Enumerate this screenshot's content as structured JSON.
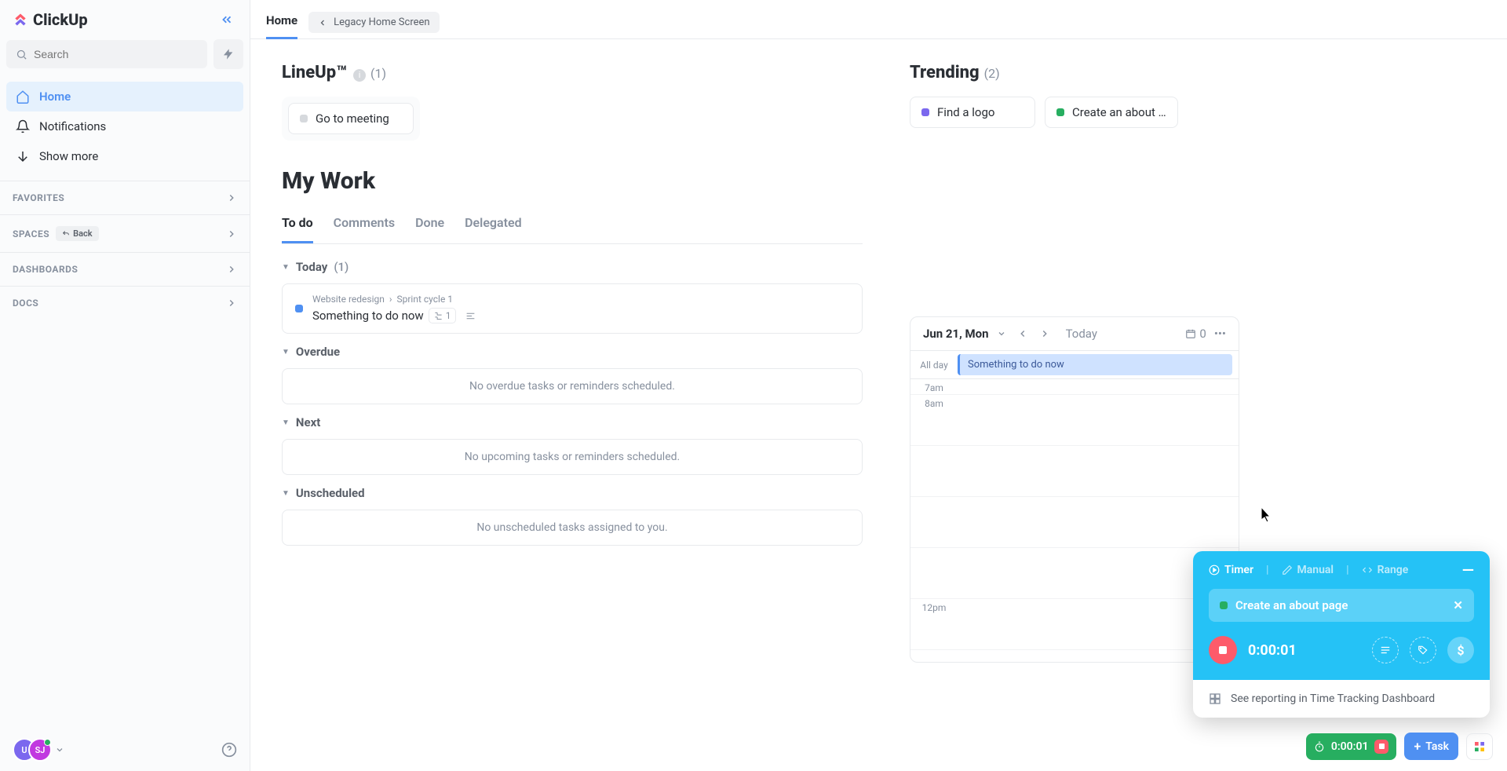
{
  "brand": "ClickUp",
  "search": {
    "placeholder": "Search"
  },
  "nav": {
    "home": "Home",
    "notifications": "Notifications",
    "showmore": "Show more"
  },
  "sections": {
    "favorites": "FAVORITES",
    "spaces": "SPACES",
    "back": "Back",
    "dashboards": "DASHBOARDS",
    "docs": "DOCS"
  },
  "avatars": {
    "u": "U",
    "sj": "SJ"
  },
  "topbar": {
    "home": "Home",
    "legacy": "Legacy Home Screen"
  },
  "lineup": {
    "title": "LineUp™",
    "count": "(1)",
    "items": [
      "Go to meeting"
    ]
  },
  "trending": {
    "title": "Trending",
    "count": "(2)",
    "items": [
      "Find a logo",
      "Create an about …"
    ]
  },
  "mywork": {
    "title": "My Work",
    "tabs": {
      "todo": "To do",
      "comments": "Comments",
      "done": "Done",
      "delegated": "Delegated"
    },
    "today": {
      "label": "Today",
      "count": "(1)",
      "task": {
        "bc1": "Website redesign",
        "bc2": "Sprint cycle 1",
        "title": "Something to do now",
        "sub": "1"
      }
    },
    "overdue": {
      "label": "Overdue",
      "empty": "No overdue tasks or reminders scheduled."
    },
    "next": {
      "label": "Next",
      "empty": "No upcoming tasks or reminders scheduled."
    },
    "unscheduled": {
      "label": "Unscheduled",
      "empty": "No unscheduled tasks assigned to you."
    }
  },
  "calendar": {
    "date": "Jun 21, Mon",
    "today": "Today",
    "count": "0",
    "allday": "All day",
    "event": "Something to do now",
    "hours": [
      "7am",
      "8am",
      "",
      "",
      "",
      "12pm"
    ]
  },
  "timer": {
    "tabs": {
      "timer": "Timer",
      "manual": "Manual",
      "range": "Range"
    },
    "task": "Create an about page",
    "value": "0:00:01",
    "dollar": "$",
    "report": "See reporting in Time Tracking Dashboard"
  },
  "bottombar": {
    "timer": "0:00:01",
    "task": "Task"
  }
}
